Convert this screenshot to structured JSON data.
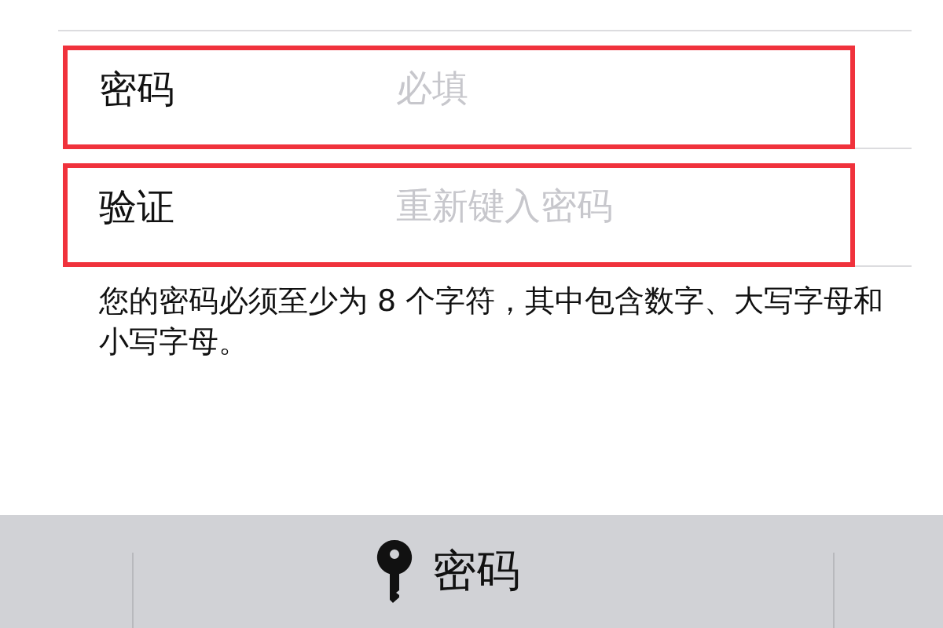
{
  "fields": [
    {
      "label": "密码",
      "placeholder": "必填",
      "highlighted": true
    },
    {
      "label": "验证",
      "placeholder": "重新键入密码",
      "highlighted": true
    }
  ],
  "note": "您的密码必须至少为 8 个字符，其中包含数字、大写字母和小写字母。",
  "toolbar": {
    "label": "密码"
  }
}
